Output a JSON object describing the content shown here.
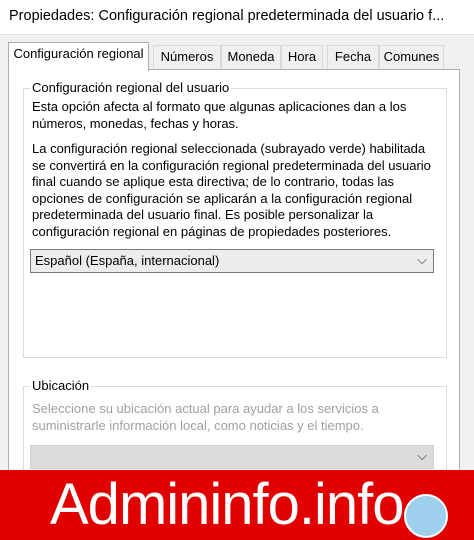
{
  "window": {
    "title": "Propiedades: Configuración regional predeterminada del usuario f..."
  },
  "tabs": [
    {
      "label": "Configuración regional",
      "active": true
    },
    {
      "label": "Números",
      "active": false
    },
    {
      "label": "Moneda",
      "active": false
    },
    {
      "label": "Hora",
      "active": false
    },
    {
      "label": "Fecha",
      "active": false
    },
    {
      "label": "Comunes",
      "active": false
    }
  ],
  "user_locale": {
    "legend": "Configuración regional del usuario",
    "line1": "Esta opción afecta al formato que algunas aplicaciones dan a los",
    "line2": "números, monedas, fechas y horas.",
    "para2": [
      "La configuración regional seleccionada (subrayado verde) habilitada",
      "se convertirá en la configuración regional predeterminada del usuario",
      "final cuando se aplique esta directiva; de lo contrario, todas las",
      "opciones de configuración se aplicarán a la configuración regional",
      "predeterminada del usuario final. Es posible personalizar la",
      "configuración regional en páginas de propiedades posteriores."
    ],
    "selected_locale": "Español (España, internacional)"
  },
  "location": {
    "legend": "Ubicación",
    "line1": "Seleccione su ubicación actual para ayudar a los servicios a",
    "line2": "suministrarle información local, como noticias y el tiempo.",
    "selected_location": ""
  },
  "watermark": {
    "text": "Admininfo.info"
  },
  "colors": {
    "accent_green": "#3c9b3c",
    "watermark_red": "#e00000"
  }
}
